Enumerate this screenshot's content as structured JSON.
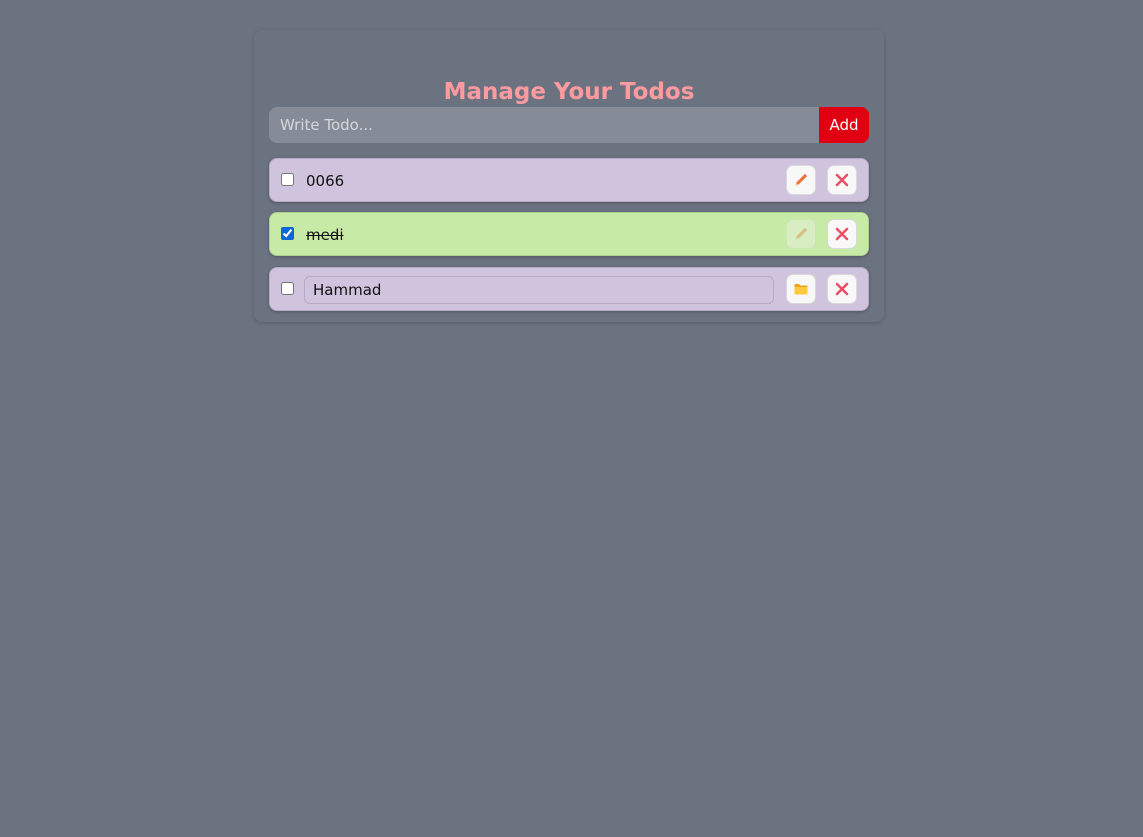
{
  "header": {
    "title": "Manage Your Todos"
  },
  "add_form": {
    "input_placeholder": "Write Todo...",
    "input_value": "",
    "add_label": "Add"
  },
  "todos": [
    {
      "text": "0066",
      "completed": false,
      "editing": false,
      "action_icon": "pencil-icon",
      "delete_icon": "close-icon"
    },
    {
      "text": "medi",
      "completed": true,
      "editing": false,
      "action_icon": "pencil-icon",
      "delete_icon": "close-icon"
    },
    {
      "text": "Hammad",
      "completed": false,
      "editing": true,
      "action_icon": "folder-icon",
      "delete_icon": "close-icon"
    }
  ],
  "colors": {
    "background": "#6b7280",
    "title": "#ff9a9e",
    "add_button": "#e00012",
    "todo_pending": "#d0c3dd",
    "todo_completed": "#c7eaa6"
  }
}
